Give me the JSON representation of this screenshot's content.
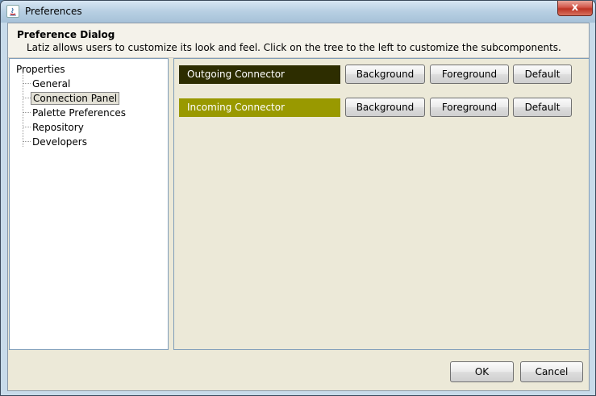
{
  "window": {
    "title": "Preferences",
    "close_glyph": "x"
  },
  "header": {
    "title": "Preference Dialog",
    "description": "Latiz allows users to customize its look and feel. Click on the tree to the left to customize the subcomponents."
  },
  "tree": {
    "root": "Properties",
    "items": [
      {
        "label": "General"
      },
      {
        "label": "Connection Panel",
        "selected": true
      },
      {
        "label": "Palette Preferences"
      },
      {
        "label": "Repository"
      },
      {
        "label": "Developers"
      }
    ]
  },
  "connectors": [
    {
      "label": "Outgoing Connector",
      "background_color": "#2d2d00",
      "text_color": "#ffffff",
      "buttons": {
        "background": "Background",
        "foreground": "Foreground",
        "default": "Default"
      }
    },
    {
      "label": "Incoming Connector",
      "background_color": "#999900",
      "text_color": "#ffffff",
      "buttons": {
        "background": "Background",
        "foreground": "Foreground",
        "default": "Default"
      }
    }
  ],
  "footer": {
    "ok_label": "OK",
    "cancel_label": "Cancel"
  }
}
